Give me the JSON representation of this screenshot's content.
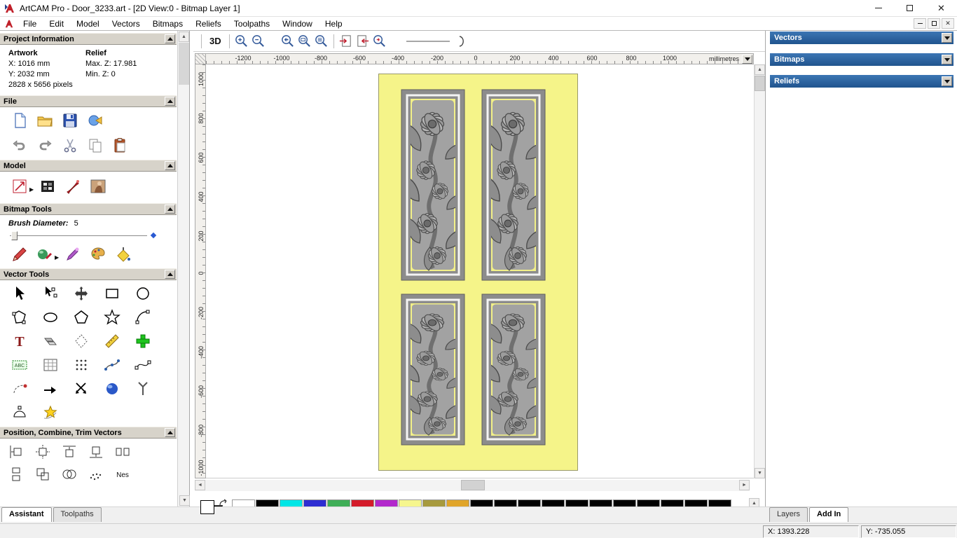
{
  "titlebar": {
    "title": "ArtCAM Pro - Door_3233.art - [2D View:0 - Bitmap Layer 1]"
  },
  "menubar": {
    "items": [
      "File",
      "Edit",
      "Model",
      "Vectors",
      "Bitmaps",
      "Reliefs",
      "Toolpaths",
      "Window",
      "Help"
    ]
  },
  "assistant_panel": {
    "project_info": {
      "title": "Project Information",
      "artwork_label": "Artwork",
      "relief_label": "Relief",
      "x": "X: 1016 mm",
      "y": "Y: 2032 mm",
      "max_z": "Max. Z: 17.981",
      "min_z": "Min. Z: 0",
      "pixels": "2828 x 5656 pixels"
    },
    "sections": {
      "file": "File",
      "model": "Model",
      "bitmap_tools": "Bitmap Tools",
      "vector_tools": "Vector Tools",
      "position": "Position, Combine, Trim Vectors"
    },
    "brush": {
      "label": "Brush Diameter:",
      "value": "5"
    },
    "tabs": {
      "assistant": "Assistant",
      "toolpaths": "Toolpaths"
    }
  },
  "view_toolbar": {
    "three_d": "3D"
  },
  "rulers": {
    "units": "millimetres",
    "horizontal": [
      "-1200",
      "-1000",
      "-800",
      "-600",
      "-400",
      "-200",
      "0",
      "200",
      "400",
      "600",
      "800",
      "1000"
    ],
    "vertical": [
      "1000",
      "800",
      "600",
      "400",
      "200",
      "0",
      "-200",
      "-400",
      "-600",
      "-800",
      "-1000"
    ]
  },
  "right_panel": {
    "vectors": "Vectors",
    "bitmaps": "Bitmaps",
    "reliefs": "Reliefs",
    "tabs": {
      "layers": "Layers",
      "addin": "Add In"
    }
  },
  "statusbar": {
    "x": "X: 1393.228",
    "y": "Y: -735.055"
  },
  "icons": {
    "text_tool": "T",
    "abc_tool": "ABC",
    "nest_tool": "Nes"
  },
  "door": {
    "background": "#f5f489",
    "panel_gray": "#8c8c8c",
    "inner_yellow": "#f2f088"
  },
  "palette": {
    "swatches": [
      "#ffffff",
      "#000000",
      "#00e6e6",
      "#2d2dd2",
      "#3fae57",
      "#d41b2a",
      "#b228cc",
      "#f6f68e",
      "#a79a3e",
      "#e0a52a",
      "#000000",
      "#000000",
      "#000000",
      "#000000",
      "#000000",
      "#000000",
      "#000000",
      "#000000",
      "#000000",
      "#000000",
      "#000000"
    ]
  }
}
